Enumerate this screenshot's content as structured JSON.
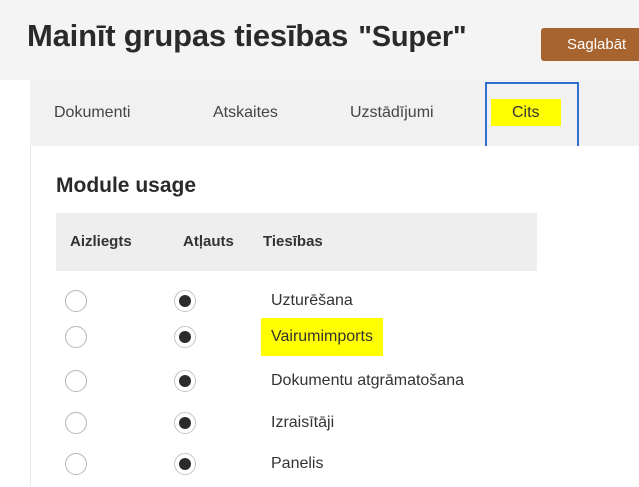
{
  "header": {
    "title": "Mainīt grupas tiesības",
    "group_name": "\"Super\"",
    "save_label": "Saglabāt"
  },
  "tabs": [
    {
      "label": "Dokumenti",
      "active": false
    },
    {
      "label": "Atskaites",
      "active": false
    },
    {
      "label": "Uzstādījumi",
      "active": false
    },
    {
      "label": "Cits",
      "active": true,
      "highlighted": true
    }
  ],
  "section": {
    "title": "Module usage"
  },
  "table": {
    "columns": [
      "Aizliegts",
      "Atļauts",
      "Tiesības"
    ],
    "rows": [
      {
        "label": "Uzturēšana",
        "value": "Atļauts",
        "highlighted": false
      },
      {
        "label": "Vairumimports",
        "value": "Atļauts",
        "highlighted": true
      },
      {
        "label": "Dokumentu atgrāmatošana",
        "value": "Atļauts",
        "highlighted": false
      },
      {
        "label": "Izraisītāji",
        "value": "Atļauts",
        "highlighted": false
      },
      {
        "label": "Panelis",
        "value": "Atļauts",
        "highlighted": false
      }
    ]
  },
  "colors": {
    "accent": "#a8642e",
    "highlight": "#ffff00",
    "focus_box": "#2f6fd0"
  }
}
